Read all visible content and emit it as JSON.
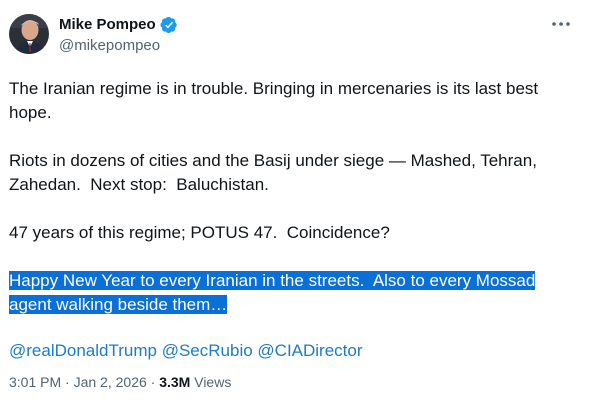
{
  "tweet": {
    "author": {
      "display_name": "Mike Pompeo",
      "handle": "@mikepompeo",
      "verified": true,
      "avatar_icon": "profile-photo"
    },
    "paragraphs": [
      "The Iranian regime is in trouble. Bringing in mercenaries is its last best hope.",
      "Riots in dozens of cities and the Basij under siege — Mashed, Tehran, Zahedan.  Next stop:  Baluchistan.",
      "47 years of this regime; POTUS 47.  Coincidence?"
    ],
    "highlighted_line_1": "Happy New Year to every Iranian in the streets.  Also to every Mossad",
    "highlighted_line_2": "agent walking beside them…",
    "mentions": [
      "@realDonaldTrump",
      "@SecRubio",
      "@CIADirector"
    ],
    "time": "3:01 PM",
    "separator": " · ",
    "date": "Jan 2, 2026",
    "views_count": "3.3M",
    "views_label": "Views"
  },
  "colors": {
    "verified_badge": "#1d9bf0",
    "mention_link": "#1d7bc7",
    "selection_highlight": "#0a6fd6",
    "secondary_text": "#536471"
  },
  "icons": {
    "more": "more-icon",
    "verified": "verified-badge-icon"
  }
}
